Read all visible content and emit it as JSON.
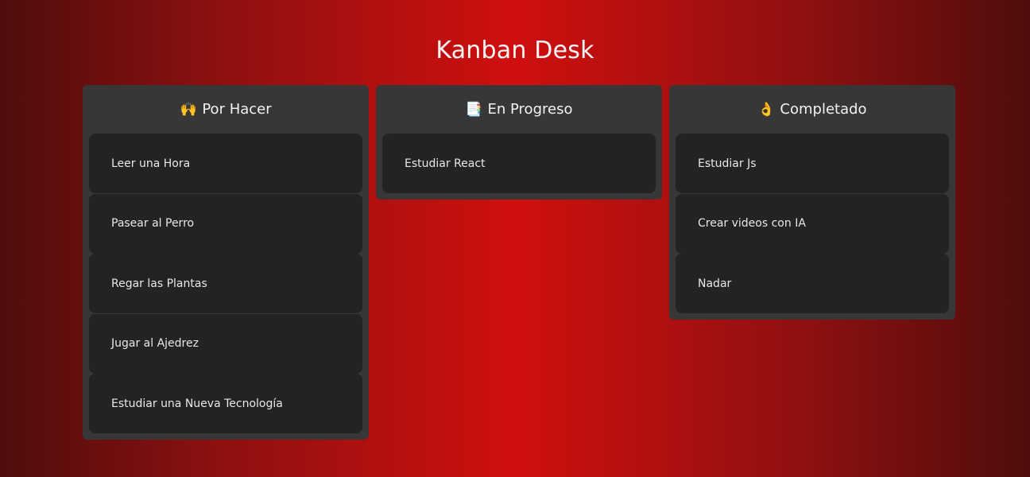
{
  "app": {
    "title": "Kanban Desk"
  },
  "columns": [
    {
      "title": "Por Hacer",
      "icon": "raised-hands-icon",
      "glyph": "🙌",
      "cards": [
        "Leer una Hora",
        "Pasear al Perro",
        "Regar las Plantas",
        "Jugar al Ajedrez",
        "Estudiar una Nueva Tecnología"
      ]
    },
    {
      "title": "En Progreso",
      "icon": "memo-icon",
      "glyph": "📑",
      "cards": [
        "Estudiar React"
      ]
    },
    {
      "title": "Completado",
      "icon": "ok-hand-icon",
      "glyph": "👌",
      "cards": [
        "Estudiar Js",
        "Crear videos con IA",
        "Nadar"
      ]
    }
  ]
}
